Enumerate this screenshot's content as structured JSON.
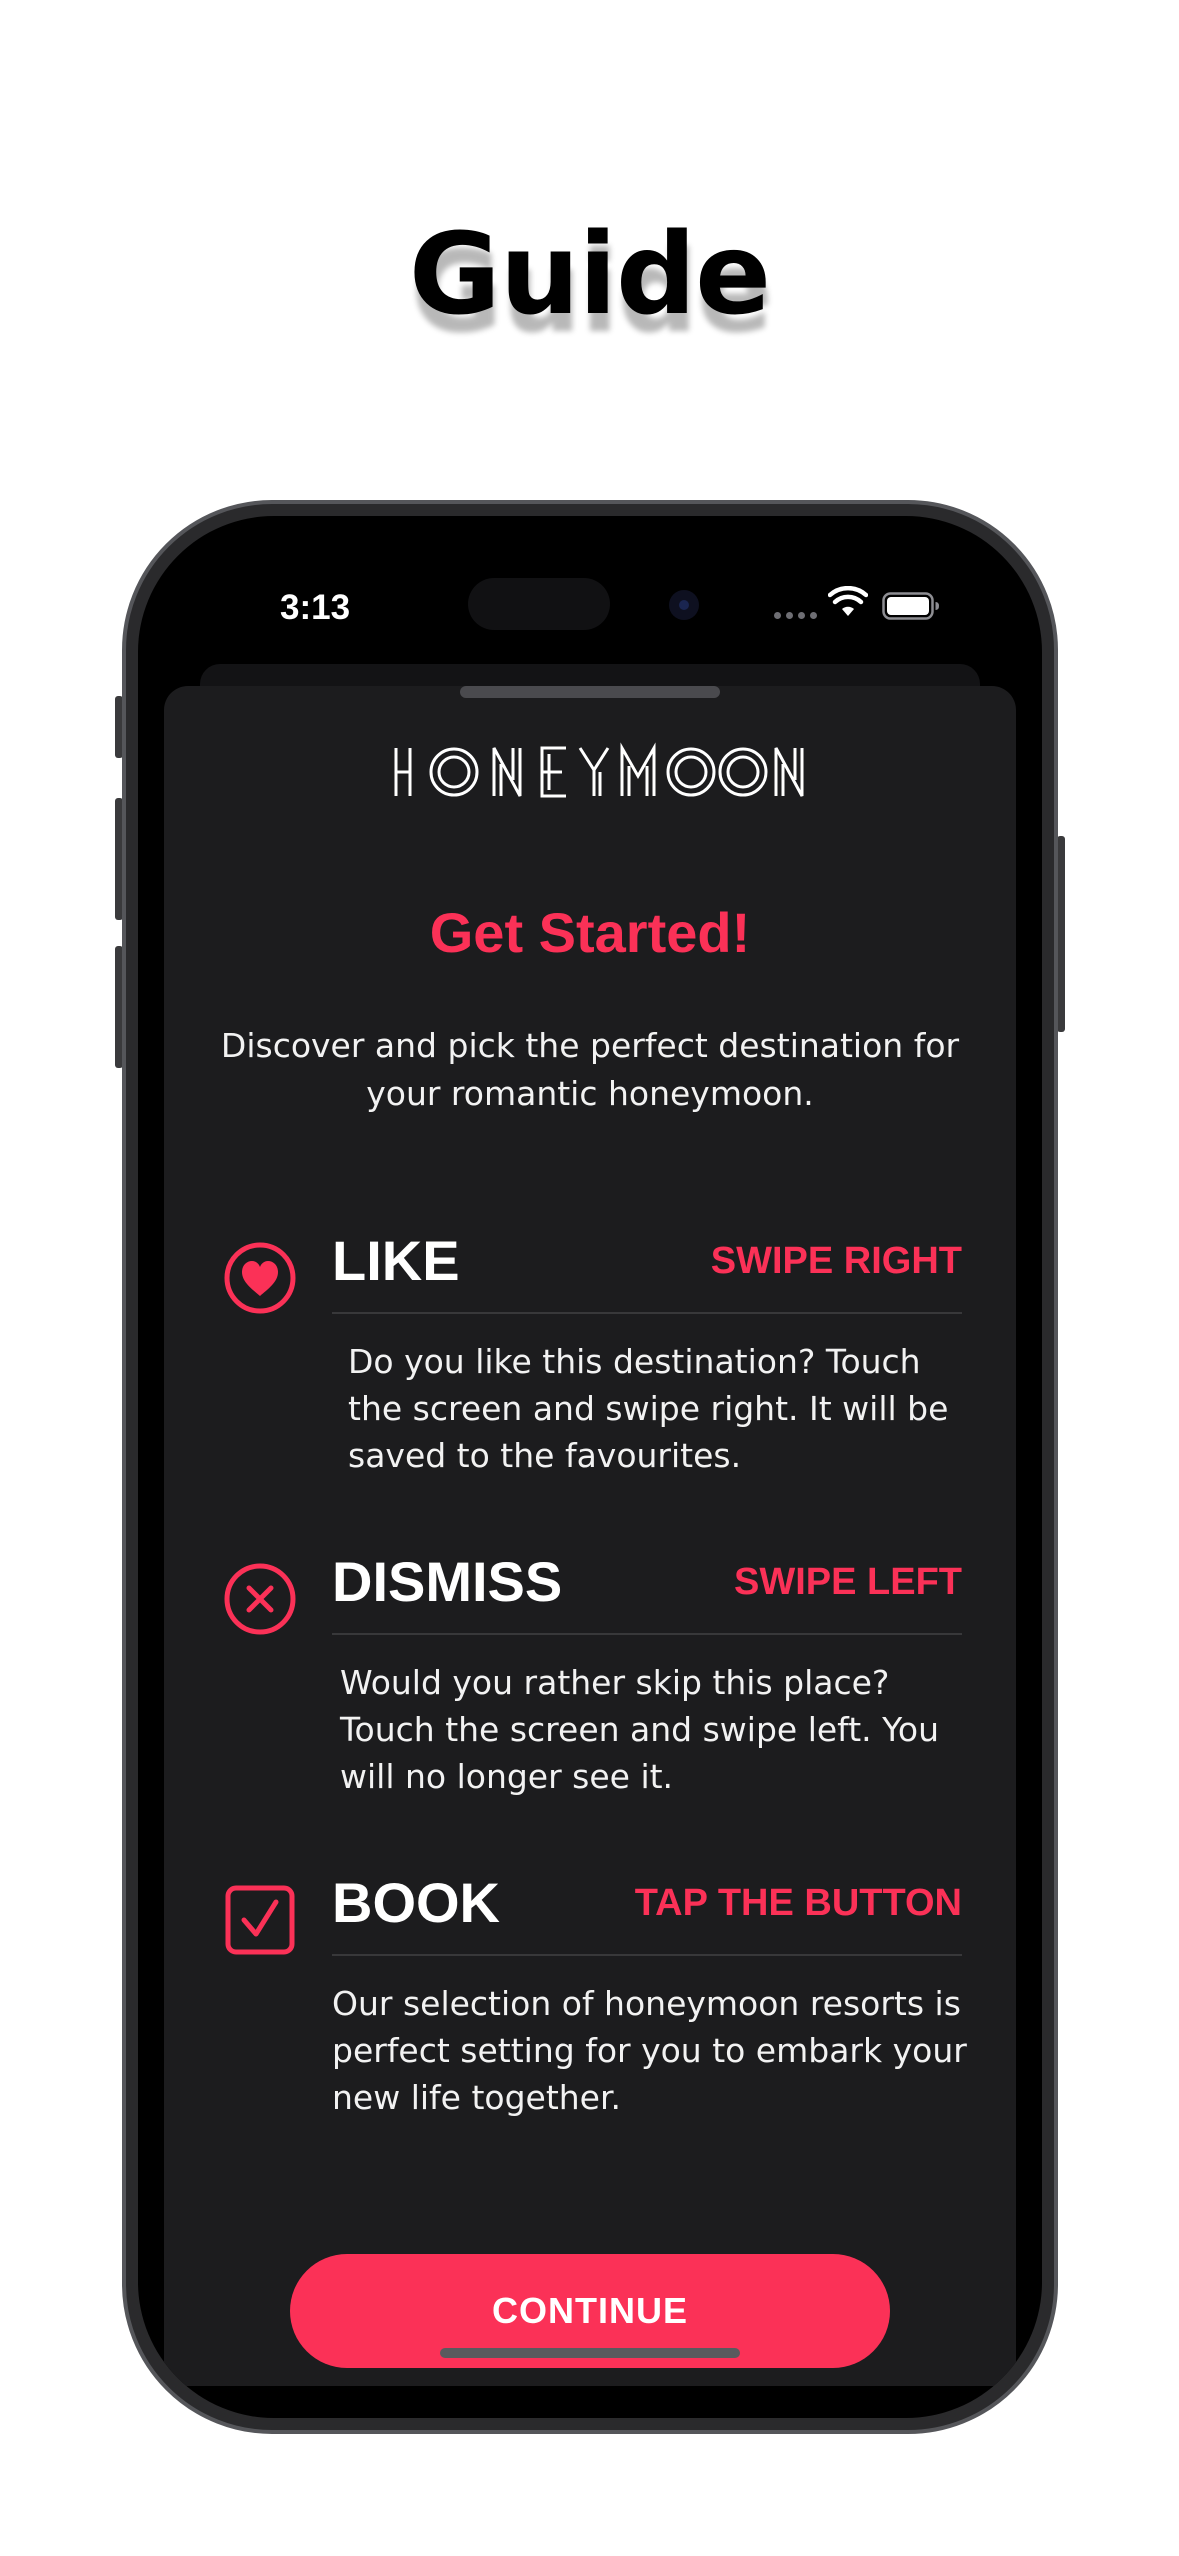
{
  "page": {
    "title": "Guide"
  },
  "status_bar": {
    "time": "3:13",
    "icons": [
      "cellular-dots-icon",
      "wifi-icon",
      "battery-icon"
    ]
  },
  "app": {
    "logo_text": "HONEYMOON",
    "headline": "Get Started!",
    "intro": "Discover and pick the perfect destination for your romantic honeymoon."
  },
  "features": [
    {
      "icon": "heart-icon",
      "title": "LIKE",
      "action": "SWIPE RIGHT",
      "description": "Do you like this destination? Touch the screen and swipe right. It will be saved to the favourites."
    },
    {
      "icon": "xmark-circle-icon",
      "title": "DISMISS",
      "action": "SWIPE LEFT",
      "description": "Would you rather skip this place? Touch the screen and swipe left. You will no longer see it."
    },
    {
      "icon": "checkmark-square-icon",
      "title": "BOOK",
      "action": "TAP THE BUTTON",
      "description": "Our selection of honeymoon resorts is perfect setting for you to embark your new life together."
    }
  ],
  "continue_button": {
    "label": "CONTINUE"
  },
  "colors": {
    "accent": "#fb3157",
    "sheet_background": "#1c1c1e",
    "text": "#ffffff"
  }
}
